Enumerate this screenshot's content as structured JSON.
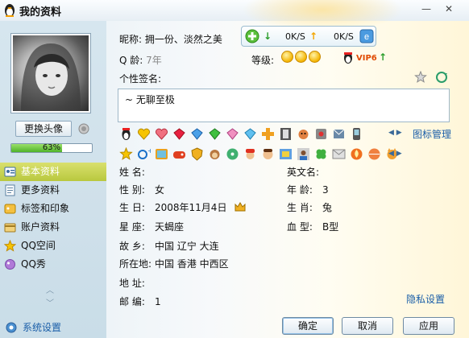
{
  "window": {
    "title": "我的资料",
    "minimize": "—",
    "close": "✕"
  },
  "avatar": {
    "change_label": "更换头像"
  },
  "profile_completion": {
    "percent": 63,
    "label": "63%"
  },
  "sidebar": {
    "items": [
      {
        "label": "基本资料",
        "icon": "id-card-icon",
        "active": true
      },
      {
        "label": "更多资料",
        "icon": "document-icon",
        "active": false
      },
      {
        "label": "标签和印象",
        "icon": "tag-icon",
        "active": false
      },
      {
        "label": "账户资料",
        "icon": "account-icon",
        "active": false
      },
      {
        "label": "QQ空间",
        "icon": "star-home-icon",
        "active": false
      },
      {
        "label": "QQ秀",
        "icon": "qq-show-icon",
        "active": false
      }
    ],
    "settings_label": "系统设置"
  },
  "header": {
    "nickname_label": "昵称:",
    "nickname_value": "拥一份、淡然之美",
    "qq_age_label": "Q 龄:",
    "qq_age_value": "7年",
    "level_label": "等级:",
    "vip_label": "VIP6"
  },
  "speed": {
    "download": "0K/S",
    "upload": "0K/S"
  },
  "signature": {
    "label": "个性签名:",
    "text": "~  无聊至极"
  },
  "icon_manager_label": "图标管理",
  "info": {
    "name_label": "姓    名:",
    "name_value": "",
    "english_name_label": "英文名:",
    "english_name_value": "",
    "gender_label": "性    别:",
    "gender_value": "女",
    "age_label": "年    龄:",
    "age_value": "3",
    "birthday_label": "生    日:",
    "birthday_value": "2008年11月4日",
    "zodiac_label": "生    肖:",
    "zodiac_value": "兔",
    "constellation_label": "星    座:",
    "constellation_value": "天蝎座",
    "blood_label": "血    型:",
    "blood_value": "B型",
    "hometown_label": "故    乡:",
    "hometown_value": "中国  辽宁  大连",
    "location_label": "所在地:",
    "location_value": "中国  香港  中西区",
    "address_label": "地    址:",
    "address_value": "",
    "postcode_label": "邮    编:",
    "postcode_value": "1",
    "privacy_label": "隐私设置"
  },
  "buttons": {
    "ok": "确定",
    "cancel": "取消",
    "apply": "应用"
  },
  "colors": {
    "link": "#1a5ea8",
    "active_nav": "#c6cf4f",
    "panel": "#cfe0ea"
  }
}
